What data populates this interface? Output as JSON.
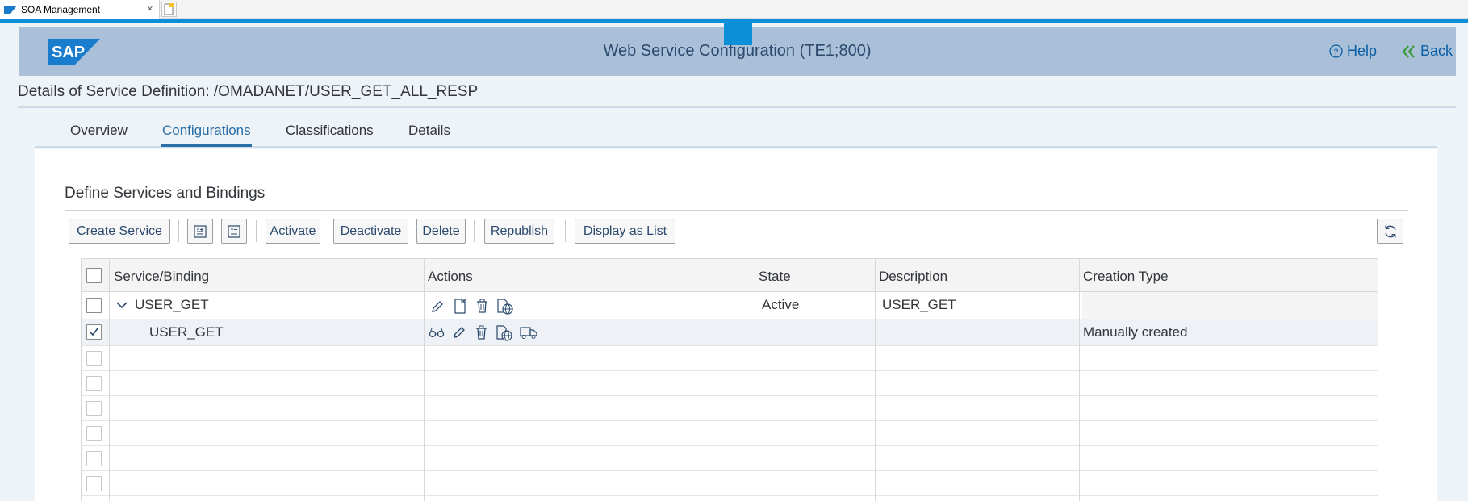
{
  "browser": {
    "tab_title": "SOA Management",
    "close_glyph": "×"
  },
  "shell": {
    "logo_text": "SAP",
    "title": "Web Service Configuration (TE1;800)",
    "help_label": "Help",
    "back_label": "Back"
  },
  "object": {
    "title": "Details of Service Definition: /OMADANET/USER_GET_ALL_RESP"
  },
  "tabs": [
    {
      "label": "Overview"
    },
    {
      "label": "Configurations"
    },
    {
      "label": "Classifications"
    },
    {
      "label": "Details"
    }
  ],
  "active_tab": "Configurations",
  "section": {
    "title": "Define Services and Bindings"
  },
  "toolbar": {
    "create_service": "Create Service",
    "expand_icon": "expand-all-icon",
    "collapse_icon": "collapse-all-icon",
    "activate": "Activate",
    "deactivate": "Deactivate",
    "delete": "Delete",
    "republish": "Republish",
    "display_as_list": "Display as List",
    "refresh_icon": "refresh-icon"
  },
  "table": {
    "columns": [
      "Service/Binding",
      "Actions",
      "State",
      "Description",
      "Creation Type"
    ],
    "rows": [
      {
        "name": "USER_GET",
        "expanded": true,
        "checked": false,
        "actions": [
          "edit-icon",
          "create-binding-icon",
          "delete-icon",
          "wsdl-icon"
        ],
        "state": "Active",
        "description": "USER_GET",
        "creation_type": ""
      },
      {
        "name": "USER_GET",
        "checked": true,
        "actions": [
          "display-icon",
          "edit-icon",
          "delete-icon",
          "wsdl-icon",
          "transport-icon"
        ],
        "state": "",
        "description": "",
        "creation_type": "Manually created"
      }
    ],
    "empty_rows": 6
  },
  "colors": {
    "accent_blue": "#0a8fd8",
    "shell_bg": "#a9c0d8",
    "link_blue": "#0a5fa6",
    "active_tab": "#2a6ea7"
  }
}
